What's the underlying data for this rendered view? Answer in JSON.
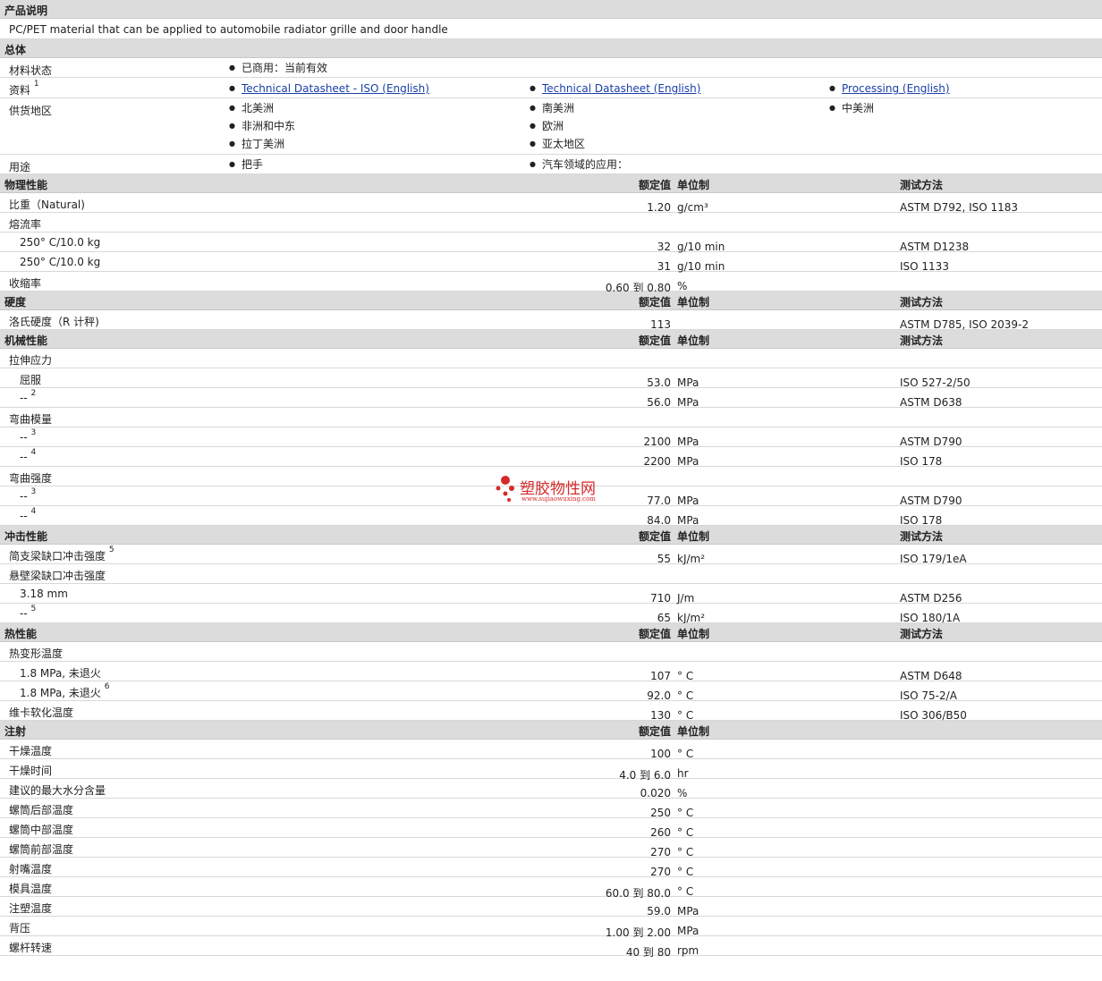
{
  "sections": {
    "desc_title": "产品说明",
    "desc_text": "PC/PET material that can be applied to automobile radiator grille and door handle",
    "general_title": "总体",
    "physical_title": "物理性能",
    "hardness_title": "硬度",
    "mechanical_title": "机械性能",
    "impact_title": "冲击性能",
    "thermal_title": "热性能",
    "injection_title": "注射"
  },
  "col_headers": {
    "value": "额定值",
    "unit": "单位制",
    "method": "测试方法"
  },
  "general": {
    "status_label": "材料状态",
    "status_value": "已商用：当前有效",
    "docs_label": "资料",
    "docs_sup": "1",
    "doc1": "Technical Datasheet - ISO (English)",
    "doc2": "Technical Datasheet (English)",
    "doc3": "Processing (English)",
    "region_label": "供货地区",
    "regions": [
      "北美洲",
      "非洲和中东",
      "拉丁美洲",
      "南美洲",
      "欧洲",
      "亚太地区",
      "中美洲"
    ],
    "use_label": "用途",
    "use1": "把手",
    "use2": "汽车领域的应用："
  },
  "physical": [
    {
      "name": "比重（Natural)",
      "value": "1.20",
      "unit": "g/cm³",
      "method": "ASTM D792, ISO 1183"
    },
    {
      "name": "熔流率",
      "value": "",
      "unit": "",
      "method": ""
    },
    {
      "name": "250° C/10.0 kg",
      "value": "32",
      "unit": "g/10 min",
      "method": "ASTM D1238",
      "indent": true
    },
    {
      "name": "250° C/10.0 kg",
      "value": "31",
      "unit": "g/10 min",
      "method": "ISO 1133",
      "indent": true
    },
    {
      "name": "收缩率",
      "value": "0.60 到 0.80",
      "unit": "%",
      "method": ""
    }
  ],
  "hardness": [
    {
      "name": "洛氏硬度（R 计秤)",
      "value": "113",
      "unit": "",
      "method": "ASTM D785, ISO 2039-2"
    }
  ],
  "mechanical": [
    {
      "name": "拉伸应力",
      "value": "",
      "unit": "",
      "method": ""
    },
    {
      "name": "屈服",
      "value": "53.0",
      "unit": "MPa",
      "method": "ISO 527-2/50",
      "indent": true
    },
    {
      "name": "--",
      "sup": "2",
      "value": "56.0",
      "unit": "MPa",
      "method": "ASTM D638",
      "indent": true
    },
    {
      "name": "弯曲模量",
      "value": "",
      "unit": "",
      "method": ""
    },
    {
      "name": "--",
      "sup": "3",
      "value": "2100",
      "unit": "MPa",
      "method": "ASTM D790",
      "indent": true
    },
    {
      "name": "--",
      "sup": "4",
      "value": "2200",
      "unit": "MPa",
      "method": "ISO 178",
      "indent": true
    },
    {
      "name": "弯曲强度",
      "value": "",
      "unit": "",
      "method": ""
    },
    {
      "name": "--",
      "sup": "3",
      "value": "77.0",
      "unit": "MPa",
      "method": "ASTM D790",
      "indent": true
    },
    {
      "name": "--",
      "sup": "4",
      "value": "84.0",
      "unit": "MPa",
      "method": "ISO 178",
      "indent": true
    }
  ],
  "impact": [
    {
      "name": "简支梁缺口冲击强度",
      "sup": "5",
      "value": "55",
      "unit": "kJ/m²",
      "method": "ISO 179/1eA"
    },
    {
      "name": "悬壁梁缺口冲击强度",
      "value": "",
      "unit": "",
      "method": ""
    },
    {
      "name": "3.18 mm",
      "value": "710",
      "unit": "J/m",
      "method": "ASTM D256",
      "indent": true
    },
    {
      "name": "--",
      "sup": "5",
      "value": "65",
      "unit": "kJ/m²",
      "method": "ISO 180/1A",
      "indent": true
    }
  ],
  "thermal": [
    {
      "name": "热变形温度",
      "value": "",
      "unit": "",
      "method": ""
    },
    {
      "name": "1.8 MPa, 未退火",
      "value": "107",
      "unit": "° C",
      "method": "ASTM D648",
      "indent": true
    },
    {
      "name": "1.8 MPa, 未退火",
      "sup": "6",
      "value": "92.0",
      "unit": "° C",
      "method": "ISO 75-2/A",
      "indent": true
    },
    {
      "name": "维卡软化温度",
      "value": "130",
      "unit": "° C",
      "method": "ISO 306/B50"
    }
  ],
  "injection": [
    {
      "name": "干燥温度",
      "value": "100",
      "unit": "° C",
      "method": ""
    },
    {
      "name": "干燥时间",
      "value": "4.0 到 6.0",
      "unit": "hr",
      "method": ""
    },
    {
      "name": "建议的最大水分含量",
      "value": "0.020",
      "unit": "%",
      "method": ""
    },
    {
      "name": "螺筒后部温度",
      "value": "250",
      "unit": "° C",
      "method": ""
    },
    {
      "name": "螺筒中部温度",
      "value": "260",
      "unit": "° C",
      "method": ""
    },
    {
      "name": "螺筒前部温度",
      "value": "270",
      "unit": "° C",
      "method": ""
    },
    {
      "name": "射嘴温度",
      "value": "270",
      "unit": "° C",
      "method": ""
    },
    {
      "name": "模具温度",
      "value": "60.0 到 80.0",
      "unit": "° C",
      "method": ""
    },
    {
      "name": "注塑温度",
      "value": "59.0",
      "unit": "MPa",
      "method": ""
    },
    {
      "name": "背压",
      "value": "1.00 到 2.00",
      "unit": "MPa",
      "method": ""
    },
    {
      "name": "螺杆转速",
      "value": "40 到 80",
      "unit": "rpm",
      "method": ""
    }
  ],
  "watermark": {
    "name": "塑胶物性网",
    "url": "www.sujiaowuxing.com",
    "color": "#d62a2a"
  }
}
